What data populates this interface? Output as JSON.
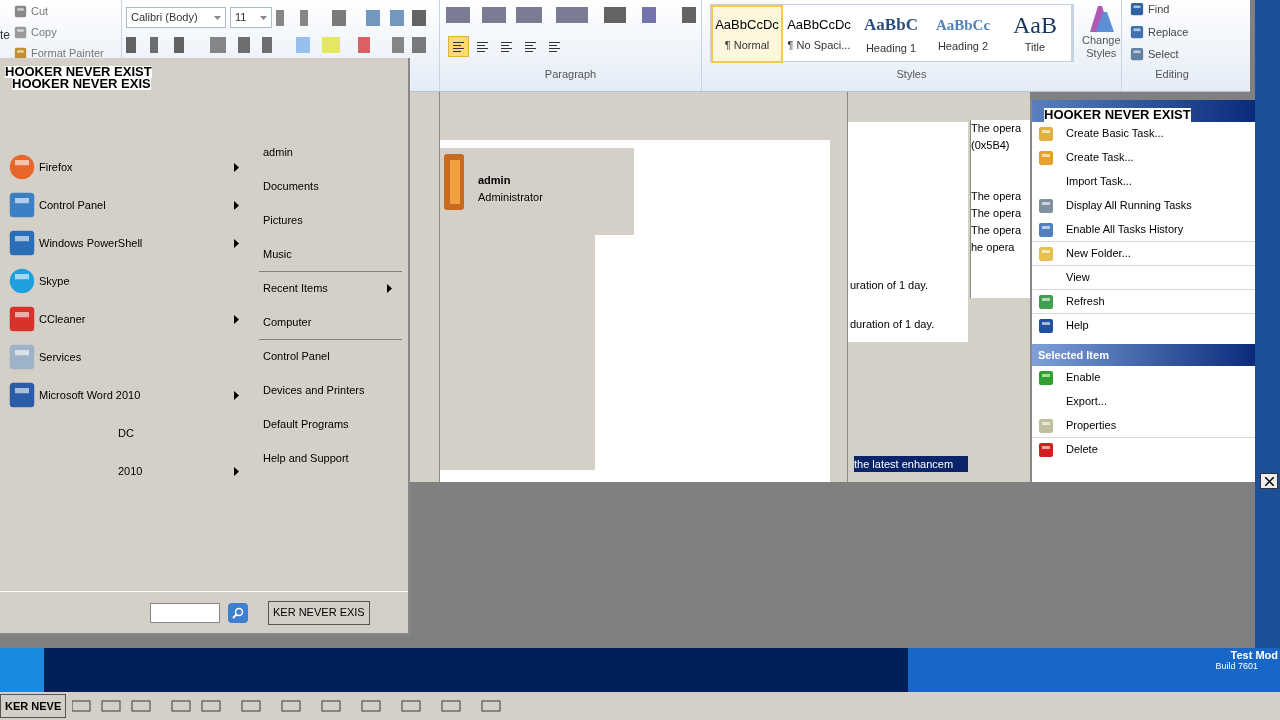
{
  "ribbon": {
    "clipboard": {
      "paste_label": "te",
      "items": [
        {
          "label": "Cut",
          "kind": "scissors"
        },
        {
          "label": "Copy",
          "kind": "copy"
        },
        {
          "label": "Format Painter",
          "kind": "brush"
        }
      ]
    },
    "font": {
      "name": "Calibri (Body)",
      "size": "11"
    },
    "paragraph": {
      "label": "Paragraph",
      "alignments": [
        {
          "selected": true
        },
        {
          "selected": false
        },
        {
          "selected": false
        },
        {
          "selected": false
        },
        {
          "selected": false
        }
      ]
    },
    "styles": {
      "label": "Styles",
      "items": [
        {
          "preview": "AaBbCcDc",
          "name": "¶ Normal",
          "kind": "normal",
          "selected": true
        },
        {
          "preview": "AaBbCcDc",
          "name": "¶ No Spaci...",
          "kind": "normal",
          "selected": false
        },
        {
          "preview": "AaBbC",
          "name": "Heading 1",
          "kind": "heading1",
          "selected": false
        },
        {
          "preview": "AaBbCc",
          "name": "Heading 2",
          "kind": "heading2",
          "selected": false
        },
        {
          "preview": "AaB",
          "name": "Title",
          "kind": "title",
          "selected": false
        }
      ],
      "change": "Change Styles"
    },
    "editing": {
      "label": "Editing",
      "items": [
        {
          "label": "Find",
          "kind": "find"
        },
        {
          "label": "Replace",
          "kind": "replace"
        },
        {
          "label": "Select",
          "kind": "select"
        }
      ]
    }
  },
  "start_menu": {
    "banner": [
      "HOOKER NEVER EXIST",
      "HOOKER NEVER EXIS"
    ],
    "programs": [
      {
        "label": "Firefox",
        "kind": "firefox",
        "submenu": true
      },
      {
        "label": "Control Panel",
        "kind": "control",
        "submenu": true
      },
      {
        "label": "Windows PowerShell",
        "kind": "powershell",
        "submenu": true
      },
      {
        "label": "Skype",
        "kind": "skype",
        "submenu": false
      },
      {
        "label": "CCleaner",
        "kind": "ccleaner",
        "submenu": true
      },
      {
        "label": "Services",
        "kind": "services",
        "submenu": false
      },
      {
        "label": "Microsoft Word 2010",
        "kind": "word",
        "submenu": true
      },
      {
        "label": "DC",
        "kind": "none",
        "submenu": false
      },
      {
        "label": "2010",
        "kind": "none",
        "submenu": true
      }
    ],
    "places": [
      {
        "label": "admin",
        "submenu": false,
        "divider_after": false
      },
      {
        "label": "Documents",
        "submenu": false,
        "divider_after": false
      },
      {
        "label": "Pictures",
        "submenu": false,
        "divider_after": false
      },
      {
        "label": "Music",
        "submenu": false,
        "divider_after": true
      },
      {
        "label": "Recent Items",
        "submenu": true,
        "divider_after": false
      },
      {
        "label": "Computer",
        "submenu": false,
        "divider_after": true
      },
      {
        "label": "Control Panel",
        "submenu": false,
        "divider_after": false
      },
      {
        "label": "Devices and Printers",
        "submenu": false,
        "divider_after": false
      },
      {
        "label": "Default Programs",
        "submenu": false,
        "divider_after": false
      },
      {
        "label": "Help and Support",
        "submenu": false,
        "divider_after": false
      }
    ],
    "shutdown": "KER NEVER EXIS"
  },
  "user_tile": {
    "name": "admin",
    "role": "Administrator"
  },
  "task_list": {
    "status_texts": [
      "The opera",
      "(0x5B4)",
      "The opera",
      "The opera",
      "The opera",
      "he opera"
    ],
    "triggers": [
      "uration of 1 day.",
      "duration of 1 day."
    ],
    "highlight": "the latest enhancem"
  },
  "actions": {
    "title": "HOOKER NEVER EXIST",
    "items": [
      {
        "label": "Create Basic Task...",
        "kind": "wizard",
        "divider_after": false
      },
      {
        "label": "Create Task...",
        "kind": "task",
        "divider_after": false
      },
      {
        "label": "Import Task...",
        "kind": "none",
        "divider_after": false
      },
      {
        "label": "Display All Running Tasks",
        "kind": "list",
        "divider_after": false
      },
      {
        "label": "Enable All Tasks History",
        "kind": "history",
        "divider_after": true
      },
      {
        "label": "New Folder...",
        "kind": "folder",
        "divider_after": true
      },
      {
        "label": "View",
        "kind": "none",
        "divider_after": true
      },
      {
        "label": "Refresh",
        "kind": "refresh",
        "divider_after": true
      },
      {
        "label": "Help",
        "kind": "help",
        "divider_after": false
      }
    ],
    "selected_header": "Selected Item",
    "selected_items": [
      {
        "label": "Enable",
        "kind": "enable",
        "divider_after": false
      },
      {
        "label": "Export...",
        "kind": "none",
        "divider_after": false
      },
      {
        "label": "Properties",
        "kind": "properties",
        "divider_after": true
      },
      {
        "label": "Delete",
        "kind": "delete",
        "divider_after": false
      }
    ]
  },
  "taskbar": {
    "button": "KER NEVE",
    "test_mode": "Test Mod",
    "build": "Build 7601"
  }
}
